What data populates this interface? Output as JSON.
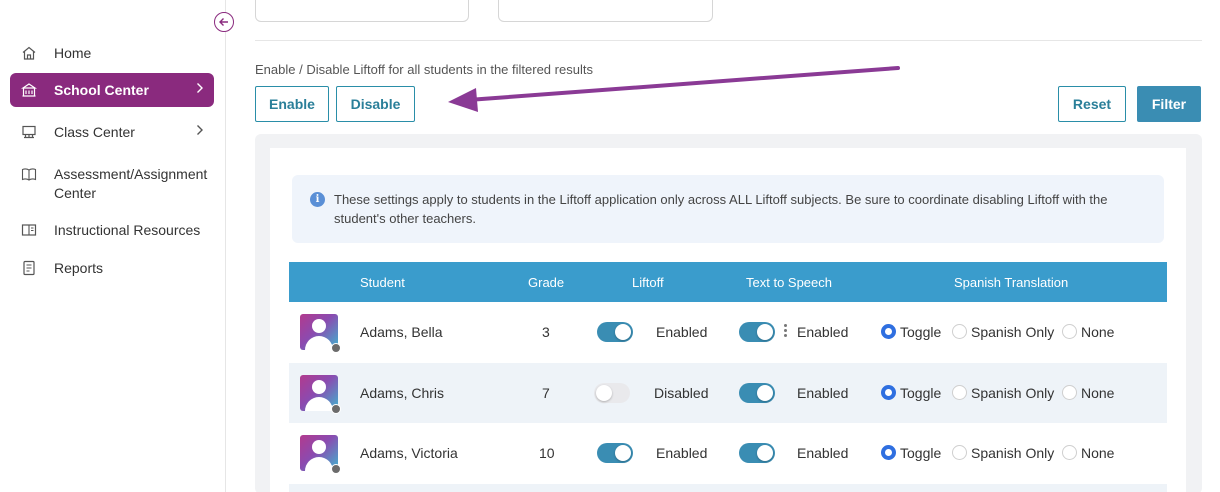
{
  "sidebar": {
    "items": [
      {
        "label": "Home",
        "icon": "home-icon"
      },
      {
        "label": "School Center",
        "icon": "school-icon",
        "active": true
      },
      {
        "label": "Class Center",
        "icon": "class-icon"
      },
      {
        "label": "Assessment/Assignment Center",
        "label_line1": "Assessment/Assignment",
        "label_line2": "Center",
        "icon": "book-icon"
      },
      {
        "label": "Instructional Resources",
        "icon": "resources-icon"
      },
      {
        "label": "Reports",
        "icon": "report-icon"
      }
    ]
  },
  "bulk": {
    "label": "Enable / Disable Liftoff for all students in the filtered results",
    "enable": "Enable",
    "disable": "Disable",
    "reset": "Reset",
    "filter": "Filter"
  },
  "notice": {
    "info_glyph": "i",
    "text": "These settings apply to students in the Liftoff application only across ALL Liftoff subjects. Be sure to coordinate disabling Liftoff with the student's other teachers."
  },
  "table": {
    "headers": {
      "student": "Student",
      "grade": "Grade",
      "liftoff": "Liftoff",
      "tts": "Text to Speech",
      "spanish": "Spanish Translation"
    },
    "options": {
      "toggle": "Toggle",
      "spanish_only": "Spanish Only",
      "none": "None"
    },
    "rows": [
      {
        "name": "Adams, Bella",
        "grade": "3",
        "liftoff_on": true,
        "liftoff_status": "Enabled",
        "tts_on": true,
        "tts_status": "Enabled",
        "translation": "Toggle"
      },
      {
        "name": "Adams, Chris",
        "grade": "7",
        "liftoff_on": false,
        "liftoff_status": "Disabled",
        "tts_on": true,
        "tts_status": "Enabled",
        "translation": "Toggle"
      },
      {
        "name": "Adams, Victoria",
        "grade": "10",
        "liftoff_on": true,
        "liftoff_status": "Enabled",
        "tts_on": true,
        "tts_status": "Enabled",
        "translation": "Toggle"
      }
    ]
  },
  "colors": {
    "brand": "#8a2a7e",
    "accent": "#3a8db3",
    "header": "#3a9ccc",
    "arrow": "#8a3a95"
  }
}
